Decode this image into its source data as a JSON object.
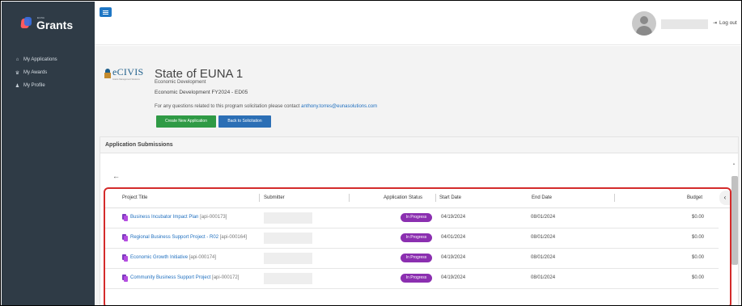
{
  "sidebar": {
    "brand_small": "EUNA",
    "brand_name": "Grants",
    "items": [
      {
        "label": "My Applications",
        "icon": "home-icon"
      },
      {
        "label": "My Awards",
        "icon": "trophy-icon"
      },
      {
        "label": "My Profile",
        "icon": "user-icon"
      }
    ]
  },
  "header": {
    "logout_label": "Log out"
  },
  "program": {
    "logo_name": "eCIVIS",
    "logo_tagline": "Grants Management Solutions",
    "title": "State of EUNA 1",
    "department": "Economic Development",
    "fiscal": "Economic Development FY2024 - ED05",
    "contact_text": "For any questions related to this program solicitation please contact",
    "contact_email": "anthony.torres@eunasolutions.com",
    "create_button": "Create New Application",
    "back_button": "Back to Solicitation"
  },
  "submissions": {
    "heading": "Application Submissions",
    "columns": {
      "title": "Project Title",
      "submitter": "Submitter",
      "status": "Application Status",
      "start": "Start Date",
      "end": "End Date",
      "budget": "Budget"
    },
    "rows": [
      {
        "title": "Business Incubator Impact Plan",
        "id": "[api-000173]",
        "status": "In Progress",
        "start": "04/19/2024",
        "end": "08/01/2024",
        "budget": "$0.00"
      },
      {
        "title": "Regional Business Support Project - R02",
        "id": "[api-000164]",
        "status": "In Progress",
        "start": "04/01/2024",
        "end": "08/01/2024",
        "budget": "$0.00"
      },
      {
        "title": "Economic Growth Initiative",
        "id": "[api-000174]",
        "status": "In Progress",
        "start": "04/19/2024",
        "end": "08/01/2024",
        "budget": "$0.00"
      },
      {
        "title": "Community Business Support Project",
        "id": "[api-000172]",
        "status": "In Progress",
        "start": "04/19/2024",
        "end": "08/01/2024",
        "budget": "$0.00"
      }
    ]
  },
  "colors": {
    "sidebar_bg": "#2f3b46",
    "primary_blue": "#2c6fb5",
    "success_green": "#2f9a45",
    "status_purple": "#8b2fb0",
    "highlight_red": "#d42b2b"
  }
}
